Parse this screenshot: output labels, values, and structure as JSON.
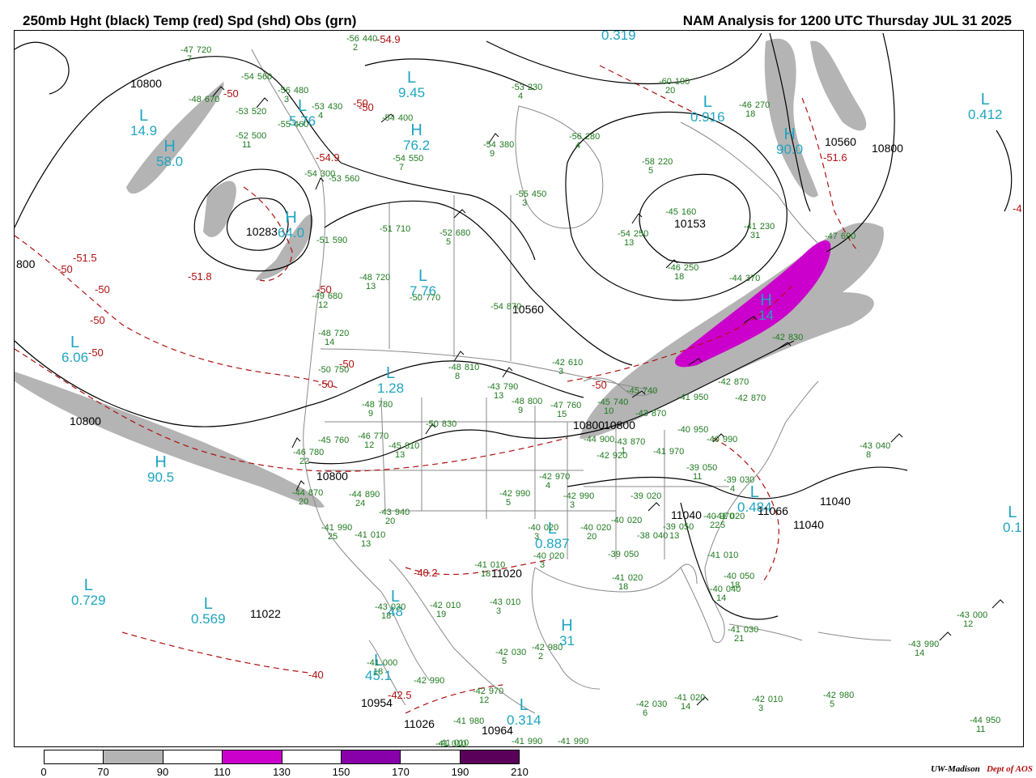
{
  "header": {
    "left_title": "250mb Hght (black) Temp (red) Spd (shd) Obs (grn)",
    "right_title": "NAM Analysis for 1200 UTC Thursday  JUL 31 2025"
  },
  "colors": {
    "height_contour": "#000000",
    "temp_contour": "#b01010",
    "obs": "#1e7a1e",
    "pressure_centers": "#1fa5c0",
    "geography": "#8a8a8a",
    "speed_70_90": "#b4b4b4",
    "speed_110_130": "#cc00cc",
    "speed_150_170": "#8800aa",
    "speed_190_210": "#5a005a"
  },
  "pressure_centers": [
    {
      "type": "L",
      "value": "14.9"
    },
    {
      "type": "H",
      "value": "58.0"
    },
    {
      "type": "L",
      "value": "9.45"
    },
    {
      "type": "H",
      "value": "76.2"
    },
    {
      "type": "L",
      "value": "5.76"
    },
    {
      "type": "H",
      "value": "64.0"
    },
    {
      "type": "L",
      "value": "0.319"
    },
    {
      "type": "L",
      "value": "0.916"
    },
    {
      "type": "L",
      "value": "0.412"
    },
    {
      "type": "H",
      "value": "90.0"
    },
    {
      "type": "L",
      "value": "7.76"
    },
    {
      "type": "L",
      "value": "6.06"
    },
    {
      "type": "L",
      "value": "1.28"
    },
    {
      "type": "H",
      "value": "90.5"
    },
    {
      "type": "L",
      "value": "0.729"
    },
    {
      "type": "L",
      "value": "0.569"
    },
    {
      "type": "L",
      "value": "0.887"
    },
    {
      "type": "L",
      "value": "0.314"
    },
    {
      "type": "H",
      "value": "31"
    },
    {
      "type": "H",
      "value": "14"
    },
    {
      "type": "L",
      "value": "0.484"
    },
    {
      "type": "L",
      "value": "0.1"
    },
    {
      "type": "L",
      "value": "48"
    },
    {
      "type": "L",
      "value": "45.1"
    }
  ],
  "height_labels": [
    "10800",
    "10283",
    "10153",
    "10560",
    "10560",
    "10800",
    "10800",
    "10800",
    "10800",
    "11040",
    "11040",
    "11022",
    "10954",
    "10964",
    "11026",
    "11020",
    "11066",
    "11040",
    "10800",
    "800"
  ],
  "temp_labels": [
    "-54.9",
    "-54.9",
    "-51.5",
    "-50",
    "-51.8",
    "-50",
    "-50",
    "-50",
    "-50",
    "-50",
    "-50",
    "-50",
    "-50",
    "-51.6",
    "-50",
    "-40",
    "-42.5",
    "-40.2",
    "-50",
    "-4"
  ],
  "obs": [
    {
      "t": "-47",
      "h": "720",
      "d": "7"
    },
    {
      "t": "-48",
      "h": "670",
      "d": ""
    },
    {
      "t": "-54",
      "h": "560",
      "d": ""
    },
    {
      "t": "-53",
      "h": "520",
      "d": ""
    },
    {
      "t": "-52",
      "h": "500",
      "d": "11"
    },
    {
      "t": "-56",
      "h": "480",
      "d": "3"
    },
    {
      "t": "-55",
      "h": "460",
      "d": ""
    },
    {
      "t": "-53",
      "h": "430",
      "d": "4"
    },
    {
      "t": "-56",
      "h": "440",
      "d": "2"
    },
    {
      "t": "-54",
      "h": "400",
      "d": ""
    },
    {
      "t": "-54",
      "h": "550",
      "d": "7"
    },
    {
      "t": "-54",
      "h": "380",
      "d": "9"
    },
    {
      "t": "-56",
      "h": "280",
      "d": "4"
    },
    {
      "t": "-53",
      "h": "230",
      "d": "4"
    },
    {
      "t": "-60",
      "h": "190",
      "d": "20"
    },
    {
      "t": "-46",
      "h": "270",
      "d": "18"
    },
    {
      "t": "-58",
      "h": "220",
      "d": "5"
    },
    {
      "t": "-55",
      "h": "450",
      "d": "3"
    },
    {
      "t": "-54",
      "h": "300",
      "d": ""
    },
    {
      "t": "-53",
      "h": "560",
      "d": ""
    },
    {
      "t": "-51",
      "h": "590",
      "d": ""
    },
    {
      "t": "-51",
      "h": "710",
      "d": ""
    },
    {
      "t": "-52",
      "h": "680",
      "d": "5"
    },
    {
      "t": "-45",
      "h": "160",
      "d": ""
    },
    {
      "t": "-54",
      "h": "250",
      "d": "13"
    },
    {
      "t": "-41",
      "h": "230",
      "d": "31"
    },
    {
      "t": "-46",
      "h": "250",
      "d": "18"
    },
    {
      "t": "-47",
      "h": "690",
      "d": ""
    },
    {
      "t": "-48",
      "h": "720",
      "d": "13"
    },
    {
      "t": "-49",
      "h": "680",
      "d": "12"
    },
    {
      "t": "-48",
      "h": "720",
      "d": "14"
    },
    {
      "t": "-50",
      "h": "770",
      "d": ""
    },
    {
      "t": "-54",
      "h": "870",
      "d": ""
    },
    {
      "t": "-44",
      "h": "370",
      "d": ""
    },
    {
      "t": "-45",
      "h": "740",
      "d": ""
    },
    {
      "t": "-42",
      "h": "830",
      "d": ""
    },
    {
      "t": "-50",
      "h": "750",
      "d": ""
    },
    {
      "t": "-48",
      "h": "780",
      "d": "9"
    },
    {
      "t": "-48",
      "h": "810",
      "d": "8"
    },
    {
      "t": "-42",
      "h": "610",
      "d": "3"
    },
    {
      "t": "-43",
      "h": "790",
      "d": "13"
    },
    {
      "t": "-48",
      "h": "800",
      "d": "9"
    },
    {
      "t": "-47",
      "h": "760",
      "d": "15"
    },
    {
      "t": "-45",
      "h": "740",
      "d": "10"
    },
    {
      "t": "-42",
      "h": "870",
      "d": ""
    },
    {
      "t": "-43",
      "h": "870",
      "d": ""
    },
    {
      "t": "-41",
      "h": "950",
      "d": ""
    },
    {
      "t": "-42",
      "h": "870",
      "d": ""
    },
    {
      "t": "-43",
      "h": "870",
      "d": "1"
    },
    {
      "t": "-45",
      "h": "760",
      "d": ""
    },
    {
      "t": "-46",
      "h": "770",
      "d": "12"
    },
    {
      "t": "-45",
      "h": "810",
      "d": "13"
    },
    {
      "t": "-50",
      "h": "830",
      "d": ""
    },
    {
      "t": "-46",
      "h": "780",
      "d": "22"
    },
    {
      "t": "-44",
      "h": "900",
      "d": ""
    },
    {
      "t": "-42",
      "h": "920",
      "d": ""
    },
    {
      "t": "-41",
      "h": "970",
      "d": ""
    },
    {
      "t": "-40",
      "h": "950",
      "d": ""
    },
    {
      "t": "-40",
      "h": "990",
      "d": ""
    },
    {
      "t": "-43",
      "h": "040",
      "d": "8"
    },
    {
      "t": "-44",
      "h": "870",
      "d": "20"
    },
    {
      "t": "-44",
      "h": "890",
      "d": "24"
    },
    {
      "t": "-43",
      "h": "940",
      "d": "20"
    },
    {
      "t": "-42",
      "h": "970",
      "d": "4"
    },
    {
      "t": "-42",
      "h": "990",
      "d": "5"
    },
    {
      "t": "-42",
      "h": "990",
      "d": "3"
    },
    {
      "t": "-40",
      "h": "020",
      "d": ""
    },
    {
      "t": "-39",
      "h": "020",
      "d": ""
    },
    {
      "t": "-39",
      "h": "050",
      "d": "11"
    },
    {
      "t": "-39",
      "h": "030",
      "d": "4"
    },
    {
      "t": "-40",
      "h": "970",
      "d": "22"
    },
    {
      "t": "-41",
      "h": "990",
      "d": "25"
    },
    {
      "t": "-41",
      "h": "010",
      "d": "13"
    },
    {
      "t": "-40",
      "h": "020",
      "d": "3"
    },
    {
      "t": "-40",
      "h": "020",
      "d": "20"
    },
    {
      "t": "-38",
      "h": "040",
      "d": ""
    },
    {
      "t": "-39",
      "h": "050",
      "d": "13"
    },
    {
      "t": "-41",
      "h": "020",
      "d": "5"
    },
    {
      "t": "-40",
      "h": "020",
      "d": "3"
    },
    {
      "t": "-39",
      "h": "050",
      "d": ""
    },
    {
      "t": "-41",
      "h": "010",
      "d": ""
    },
    {
      "t": "-41",
      "h": "010",
      "d": "18"
    },
    {
      "t": "-41",
      "h": "020",
      "d": "18"
    },
    {
      "t": "-40",
      "h": "050",
      "d": "18"
    },
    {
      "t": "-40",
      "h": "040",
      "d": "14"
    },
    {
      "t": "-43",
      "h": "030",
      "d": "18"
    },
    {
      "t": "-42",
      "h": "010",
      "d": "19"
    },
    {
      "t": "-43",
      "h": "010",
      "d": "3"
    },
    {
      "t": "-41",
      "h": "030",
      "d": "21"
    },
    {
      "t": "-43",
      "h": "000",
      "d": "12"
    },
    {
      "t": "-43",
      "h": "990",
      "d": "14"
    },
    {
      "t": "-42",
      "h": "030",
      "d": "5"
    },
    {
      "t": "-42",
      "h": "980",
      "d": "2"
    },
    {
      "t": "-41",
      "h": "000",
      "d": "18"
    },
    {
      "t": "-42",
      "h": "990",
      "d": ""
    },
    {
      "t": "-42",
      "h": "970",
      "d": "12"
    },
    {
      "t": "-41",
      "h": "980",
      "d": ""
    },
    {
      "t": "-42",
      "h": "030",
      "d": "6"
    },
    {
      "t": "-41",
      "h": "020",
      "d": "14"
    },
    {
      "t": "-42",
      "h": "010",
      "d": "3"
    },
    {
      "t": "-42",
      "h": "980",
      "d": "5"
    },
    {
      "t": "-44",
      "h": "950",
      "d": "11"
    },
    {
      "t": "-41",
      "h": "010",
      "d": ""
    },
    {
      "t": "-41",
      "h": "990",
      "d": ""
    },
    {
      "t": "-41",
      "h": "990",
      "d": ""
    },
    {
      "t": "-41",
      "h": "010",
      "d": ""
    }
  ],
  "legend": {
    "labels": [
      "0",
      "70",
      "90",
      "110",
      "130",
      "150",
      "170",
      "190",
      "210"
    ],
    "colors": [
      "#ffffff",
      "#b4b4b4",
      "#ffffff",
      "#cc00cc",
      "#ffffff",
      "#8800aa",
      "#ffffff",
      "#5a005a"
    ]
  },
  "credit": {
    "institution": "UW-Madison",
    "dept": "Dept of AOS"
  }
}
